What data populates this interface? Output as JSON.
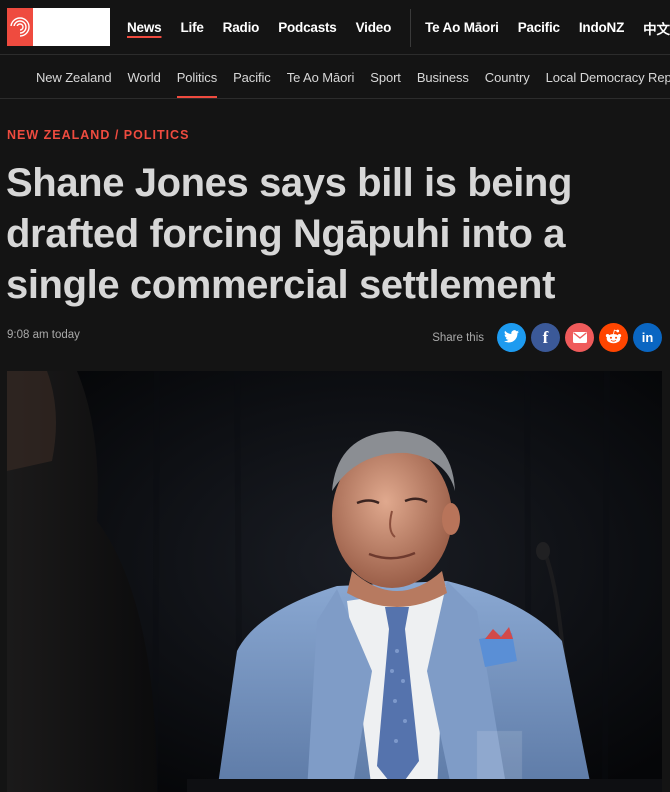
{
  "header": {
    "logo_alt": "RNZ",
    "nav": [
      "News",
      "Life",
      "Radio",
      "Podcasts",
      "Video",
      "Te Ao Māori",
      "Pacific",
      "IndoNZ",
      "中文"
    ],
    "active_nav": "News"
  },
  "subnav": {
    "items": [
      "New Zealand",
      "World",
      "Politics",
      "Pacific",
      "Te Ao Māori",
      "Sport",
      "Business",
      "Country",
      "Local Democracy Reporting"
    ],
    "active": "Politics"
  },
  "article": {
    "kicker": "NEW ZEALAND / POLITICS",
    "headline": "Shane Jones says bill is being drafted forcing Ngāpuhi into a single commercial settlement",
    "timestamp": "9:08 am today",
    "share_label": "Share this",
    "share_buttons": [
      {
        "name": "twitter-icon",
        "glyph": "✈",
        "color": "#1d9bf0"
      },
      {
        "name": "facebook-icon",
        "glyph": "f",
        "color": "#3b5998"
      },
      {
        "name": "email-icon",
        "glyph": "✉",
        "color": "#ef5b5b"
      },
      {
        "name": "reddit-icon",
        "glyph": "☺",
        "color": "#ff4500"
      },
      {
        "name": "linkedin-icon",
        "glyph": "in",
        "color": "#0a66c2"
      }
    ]
  },
  "colors": {
    "accent": "#ef4b3f",
    "background": "#141414",
    "headline": "#d7d7d7"
  }
}
